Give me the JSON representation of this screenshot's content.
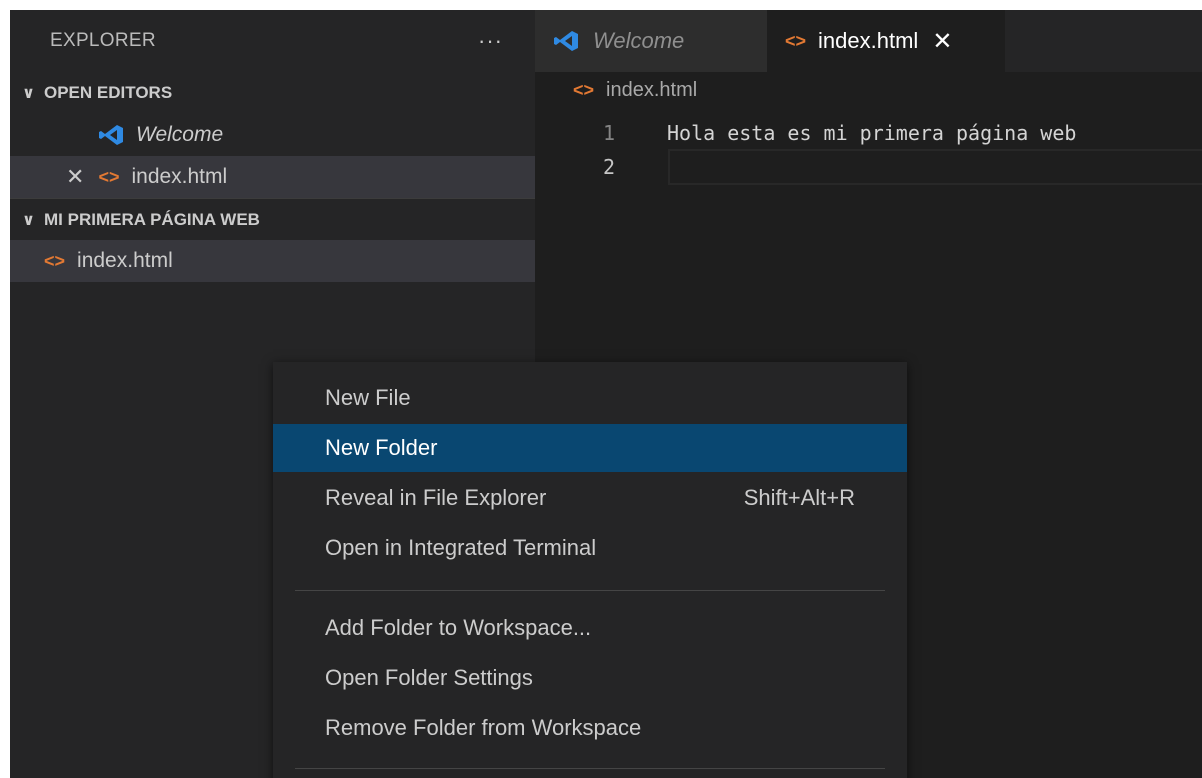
{
  "sidebar": {
    "title": "EXPLORER",
    "more_label": "···",
    "open_editors": {
      "header": "OPEN EDITORS",
      "items": [
        {
          "label": "Welcome",
          "icon": "vscode-icon"
        },
        {
          "label": "index.html",
          "icon": "html-icon",
          "close": "✕"
        }
      ]
    },
    "workspace": {
      "header": "MI PRIMERA PÁGINA WEB",
      "files": [
        {
          "label": "index.html",
          "icon": "html-icon"
        }
      ]
    },
    "chevron": "∨",
    "html_glyph": "<>"
  },
  "tabs": [
    {
      "label": "Welcome",
      "icon": "vscode-icon",
      "active": false
    },
    {
      "label": "index.html",
      "icon": "html-icon",
      "active": true,
      "close": "✕"
    }
  ],
  "editor": {
    "breadcrumb": "index.html",
    "lines": [
      {
        "number": "1",
        "text": "Hola esta es mi primera página web"
      },
      {
        "number": "2",
        "text": ""
      }
    ]
  },
  "context_menu": {
    "items": [
      {
        "label": "New File",
        "shortcut": ""
      },
      {
        "label": "New Folder",
        "shortcut": "",
        "highlighted": true
      },
      {
        "label": "Reveal in File Explorer",
        "shortcut": "Shift+Alt+R"
      },
      {
        "label": "Open in Integrated Terminal",
        "shortcut": ""
      },
      {
        "label": "Add Folder to Workspace...",
        "shortcut": ""
      },
      {
        "label": "Open Folder Settings",
        "shortcut": ""
      },
      {
        "label": "Remove Folder from Workspace",
        "shortcut": ""
      }
    ]
  },
  "colors": {
    "accent_highlight": "#094771",
    "html_icon": "#e37933",
    "vscode_icon": "#2f8ae3"
  }
}
